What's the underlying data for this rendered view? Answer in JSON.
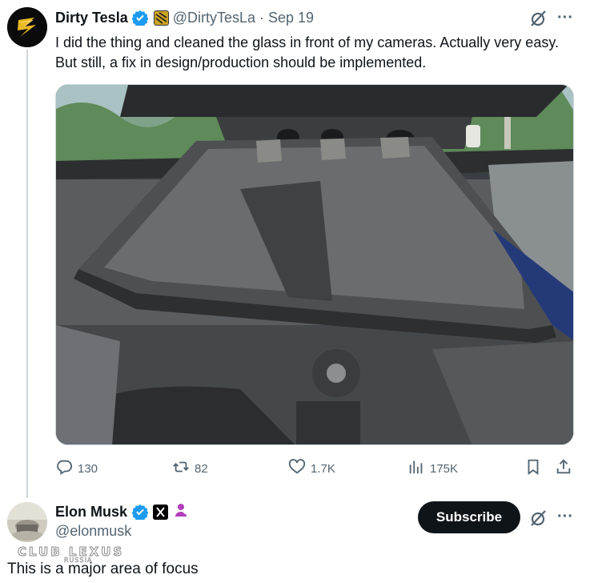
{
  "tweet": {
    "author_name": "Dirty Tesla",
    "handle": "@DirtyTesLa",
    "separator": "·",
    "date": "Sep 19",
    "text": "I did the thing and cleaned the glass in front of my cameras. Actually very easy. But still, a fix in design/production should be implemented.",
    "media_icon": "photo-of-car-camera-shroud",
    "actions": {
      "replies": "130",
      "reposts": "82",
      "likes": "1.7K",
      "views": "175K"
    }
  },
  "reply": {
    "author_name": "Elon Musk",
    "handle": "@elonmusk",
    "subscribe_label": "Subscribe",
    "text": "This is a major area of focus"
  },
  "watermark": {
    "main": "CLUB LEXUS",
    "sub": "RUSSIA"
  },
  "colors": {
    "verified_blue": "#1d9bf0",
    "secondary_text": "#536471",
    "subscribe_bg": "#0f1419",
    "thread_line": "#cfd9de"
  },
  "icons": [
    "verified-badge-icon",
    "affiliate-badge-icon",
    "grok-icon",
    "more-icon",
    "reply-icon",
    "repost-icon",
    "like-icon",
    "views-icon",
    "bookmark-icon",
    "share-icon",
    "x-badge-icon",
    "person-badge-icon"
  ]
}
